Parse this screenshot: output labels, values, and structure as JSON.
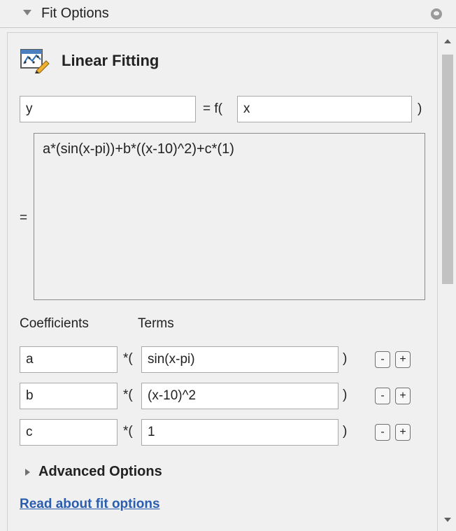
{
  "panel": {
    "title": "Fit Options",
    "icons": {
      "collapse": "triangle-down-icon",
      "help": "circle-chevron-icon"
    }
  },
  "section": {
    "title": "Linear Fitting",
    "icon": "linear-fitting-icon"
  },
  "equation": {
    "y_value": "y",
    "equals_f": "= f(",
    "x_value": "x",
    "close_paren": ")",
    "equals": "=",
    "expression": "a*(sin(x-pi))+b*((x-10)^2)+c*(1)"
  },
  "columns": {
    "coefficients": "Coefficients",
    "terms": "Terms"
  },
  "rows": [
    {
      "coef": "a",
      "mult": "*(",
      "term": "sin(x-pi)",
      "close": ")",
      "minus": "-",
      "plus": "+"
    },
    {
      "coef": "b",
      "mult": "*(",
      "term": "(x-10)^2",
      "close": ")",
      "minus": "-",
      "plus": "+"
    },
    {
      "coef": "c",
      "mult": "*(",
      "term": "1",
      "close": ")",
      "minus": "-",
      "plus": "+"
    }
  ],
  "advanced": {
    "label": "Advanced Options"
  },
  "link": {
    "label": "Read about fit options"
  },
  "colors": {
    "link": "#2a5db0",
    "background": "#f0f0f0",
    "scroll_thumb": "#c2c2c2"
  }
}
